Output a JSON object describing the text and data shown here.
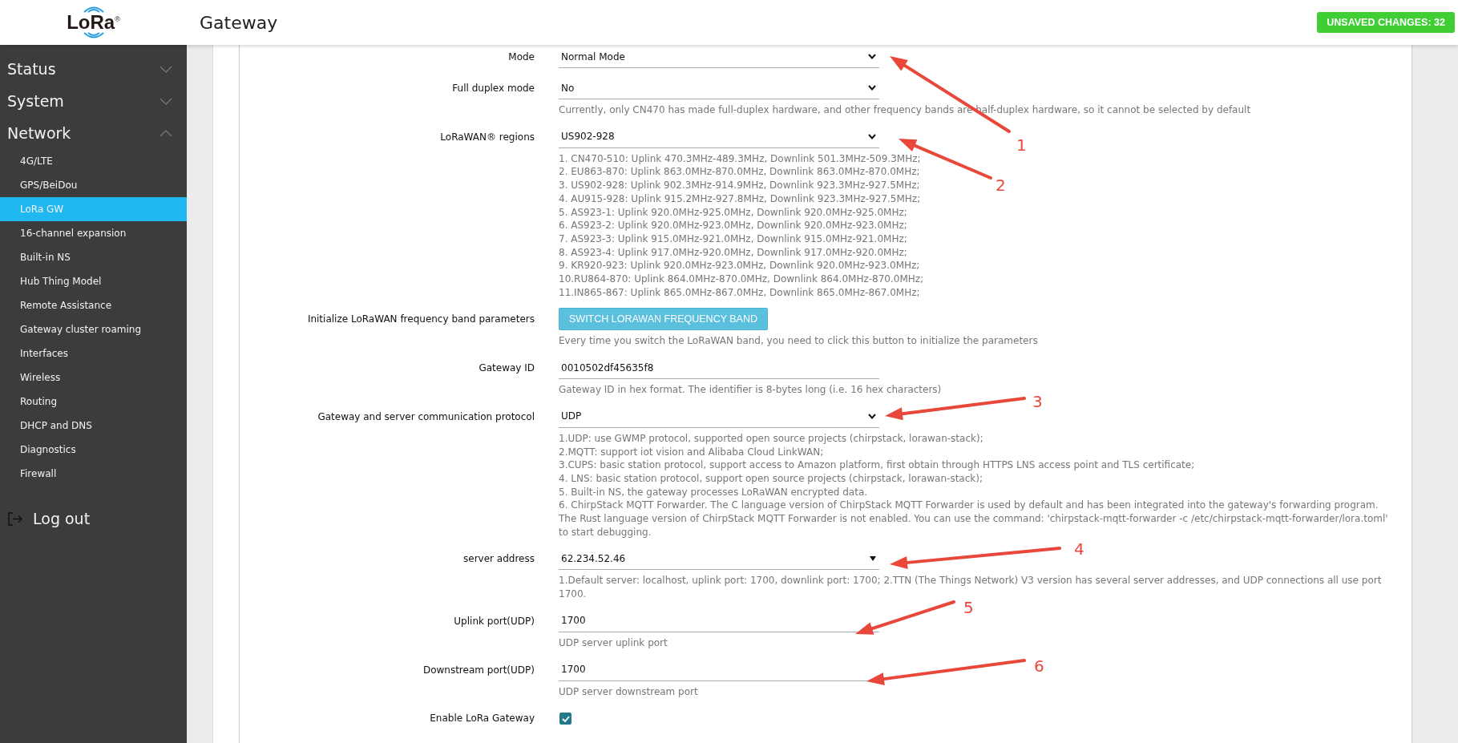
{
  "header": {
    "logo": "LoRa$^{®}$",
    "title": "Gateway",
    "badge": "UNSAVED CHANGES: 32"
  },
  "sidebar": {
    "items": [
      {
        "label": "Status",
        "expanded": false
      },
      {
        "label": "System",
        "expanded": false
      },
      {
        "label": "Network",
        "expanded": true,
        "children": [
          {
            "label": "4G/LTE",
            "selected": false
          },
          {
            "label": "GPS/BeiDou",
            "selected": false
          },
          {
            "label": "LoRa GW",
            "selected": true
          },
          {
            "label": "16-channel expansion",
            "selected": false
          },
          {
            "label": "Built-in NS",
            "selected": false
          },
          {
            "label": "Hub Thing Model",
            "selected": false
          },
          {
            "label": "Remote Assistance",
            "selected": false
          },
          {
            "label": "Gateway cluster roaming",
            "selected": false
          },
          {
            "label": "Interfaces",
            "selected": false
          },
          {
            "label": "Wireless",
            "selected": false
          },
          {
            "label": "Routing",
            "selected": false
          },
          {
            "label": "DHCP and DNS",
            "selected": false
          },
          {
            "label": "Diagnostics",
            "selected": false
          },
          {
            "label": "Firewall",
            "selected": false
          }
        ]
      }
    ],
    "logout": "Log out"
  },
  "form": {
    "fields": [
      {
        "kind": "select",
        "label": "Mode",
        "value": "Normal Mode"
      },
      {
        "kind": "select",
        "label": "Full duplex mode",
        "value": "No",
        "hint": [
          "Currently, only CN470 has made full-duplex hardware, and other frequency bands are half-duplex hardware, so it cannot be selected by default"
        ]
      },
      {
        "kind": "select",
        "label": "LoRaWAN® regions",
        "value": "US902-928",
        "hint": [
          "1. CN470-510: Uplink 470.3MHz-489.3MHz, Downlink 501.3MHz-509.3MHz;",
          "2. EU863-870: Uplink 863.0MHz-870.0MHz, Downlink 863.0MHz-870.0MHz;",
          "3. US902-928: Uplink 902.3MHz-914.9MHz, Downlink 923.3MHz-927.5MHz;",
          "4. AU915-928: Uplink 915.2MHz-927.8MHz, Downlink 923.3MHz-927.5MHz;",
          "5. AS923-1: Uplink 920.0MHz-925.0MHz, Downlink 920.0MHz-925.0MHz;",
          "6. AS923-2: Uplink 920.0MHz-923.0MHz, Downlink 920.0MHz-923.0MHz;",
          "7. AS923-3: Uplink 915.0MHz-921.0MHz, Downlink 915.0MHz-921.0MHz;",
          "8. AS923-4: Uplink 917.0MHz-920.0MHz, Downlink 917.0MHz-920.0MHz;",
          "9. KR920-923: Uplink 920.0MHz-923.0MHz, Downlink 920.0MHz-923.0MHz;",
          "10.RU864-870: Uplink 864.0MHz-870.0MHz, Downlink 864.0MHz-870.0MHz;",
          "11.IN865-867: Uplink 865.0MHz-867.0MHz, Downlink 865.0MHz-867.0MHz;"
        ]
      },
      {
        "kind": "button",
        "label": "Initialize LoRaWAN frequency band parameters",
        "value": "SWITCH LORAWAN FREQUENCY BAND",
        "hint": [
          "Every time you switch the LoRaWAN band, you need to click this button to initialize the parameters"
        ]
      },
      {
        "kind": "input",
        "label": "Gateway ID",
        "value": "0010502df45635f8",
        "hint": [
          "Gateway ID in hex format. The identifier is 8-bytes long (i.e. 16 hex characters)"
        ]
      },
      {
        "kind": "select",
        "label": "Gateway and server communication protocol",
        "value": "UDP",
        "hint": [
          "1.UDP: use GWMP protocol, supported open source projects (chirpstack, lorawan-stack);",
          "2.MQTT: support iot vision and Alibaba Cloud LinkWAN;",
          "3.CUPS: basic station protocol, support access to Amazon platform, first obtain through HTTPS LNS access point and TLS certificate;",
          "4. LNS: basic station protocol, support open source projects (chirpstack, lorawan-stack);",
          "5. Built-in NS, the gateway processes LoRaWAN encrypted data.",
          "6. ChirpStack MQTT Forwarder. The C language version of ChirpStack MQTT Forwarder is used by default and has been integrated into the gateway's forwarding program. The Rust language version of ChirpStack MQTT Forwarder is not enabled. You can use the command: 'chirpstack-mqtt-forwarder -c /etc/chirpstack-mqtt-forwarder/lora.toml' to start debugging."
        ]
      },
      {
        "kind": "combo",
        "label": "server address",
        "value": "62.234.52.46",
        "hint": [
          "1.Default server: localhost, uplink port: 1700, downlink port: 1700; 2.TTN (The Things Network) V3 version has several server addresses, and UDP connections all use port 1700."
        ]
      },
      {
        "kind": "input",
        "label": "Uplink port(UDP)",
        "value": "1700",
        "hint": [
          "UDP server uplink port"
        ]
      },
      {
        "kind": "input",
        "label": "Downstream port(UDP)",
        "value": "1700",
        "hint": [
          "UDP server downstream port"
        ]
      },
      {
        "kind": "checkbox",
        "label": "Enable LoRa Gateway",
        "checked": true
      }
    ]
  },
  "annotations": [
    {
      "label": "1"
    },
    {
      "label": "2"
    },
    {
      "label": "3"
    },
    {
      "label": "4"
    },
    {
      "label": "5"
    },
    {
      "label": "6"
    }
  ]
}
